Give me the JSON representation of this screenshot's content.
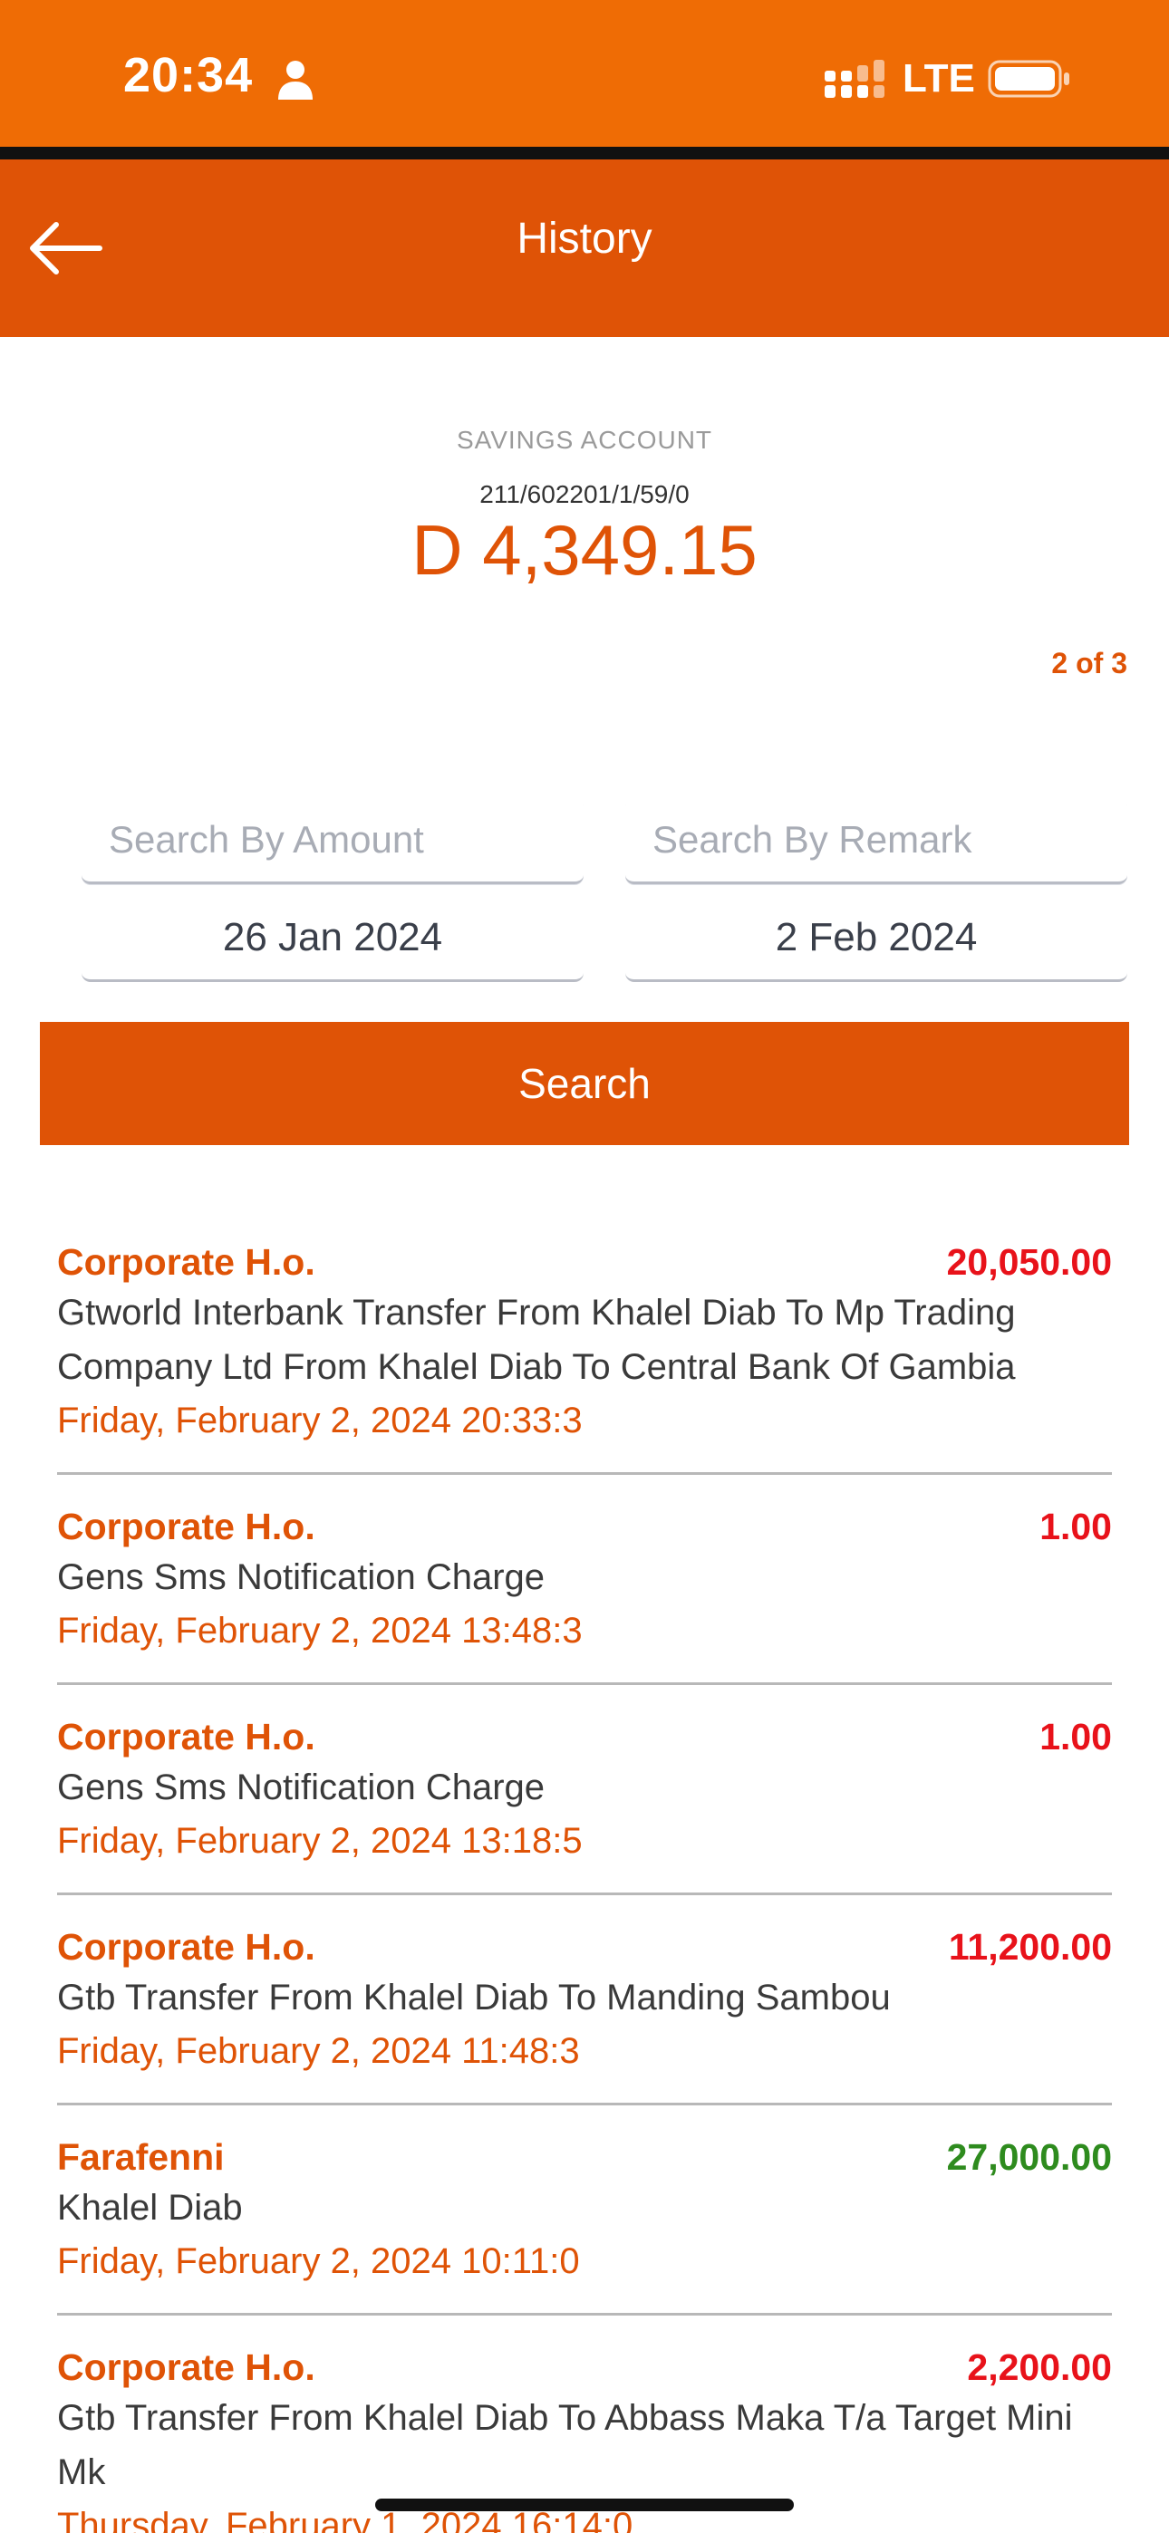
{
  "status_bar": {
    "time": "20:34",
    "network": "LTE",
    "icons": [
      "person-icon",
      "signal-icon",
      "battery-icon"
    ],
    "color": "#ef6c05"
  },
  "header": {
    "title": "History",
    "back_icon": "arrow-left-icon",
    "color": "#df5306"
  },
  "account": {
    "type": "SAVINGS ACCOUNT",
    "number": "211/602201/1/59/0",
    "balance": "D 4,349.15"
  },
  "pagination": {
    "label": "2 of 3"
  },
  "search": {
    "amount_placeholder": "Search By Amount",
    "remark_placeholder": "Search By Remark",
    "amount_value": "",
    "remark_value": "",
    "from_date": "26 Jan 2024",
    "to_date": "2 Feb 2024",
    "button_label": "Search"
  },
  "transactions": [
    {
      "branch": "Corporate H.o.",
      "amount": "20,050.00",
      "type": "debit",
      "remark": "Gtworld Interbank Transfer From Khalel Diab To Mp Trading Company Ltd From Khalel Diab To Central Bank Of Gambia",
      "date": "Friday, February 2, 2024 20:33:3"
    },
    {
      "branch": "Corporate H.o.",
      "amount": "1.00",
      "type": "debit",
      "remark": "Gens Sms Notification Charge",
      "date": "Friday, February 2, 2024 13:48:3"
    },
    {
      "branch": "Corporate H.o.",
      "amount": "1.00",
      "type": "debit",
      "remark": "Gens Sms Notification Charge",
      "date": "Friday, February 2, 2024 13:18:5"
    },
    {
      "branch": "Corporate H.o.",
      "amount": "11,200.00",
      "type": "debit",
      "remark": "Gtb Transfer From Khalel Diab To Manding Sambou",
      "date": "Friday, February 2, 2024 11:48:3"
    },
    {
      "branch": "Farafenni",
      "amount": "27,000.00",
      "type": "credit",
      "remark": "Khalel Diab",
      "date": "Friday, February 2, 2024 10:11:0"
    },
    {
      "branch": "Corporate H.o.",
      "amount": "2,200.00",
      "type": "debit",
      "remark": "Gtb Transfer From Khalel Diab To Abbass Maka T/a Target Mini Mk",
      "date": "Thursday, February 1, 2024 16:14:0"
    }
  ],
  "colors": {
    "accent": "#df5306",
    "debit": "#e8121a",
    "credit": "#2e8b1e"
  }
}
